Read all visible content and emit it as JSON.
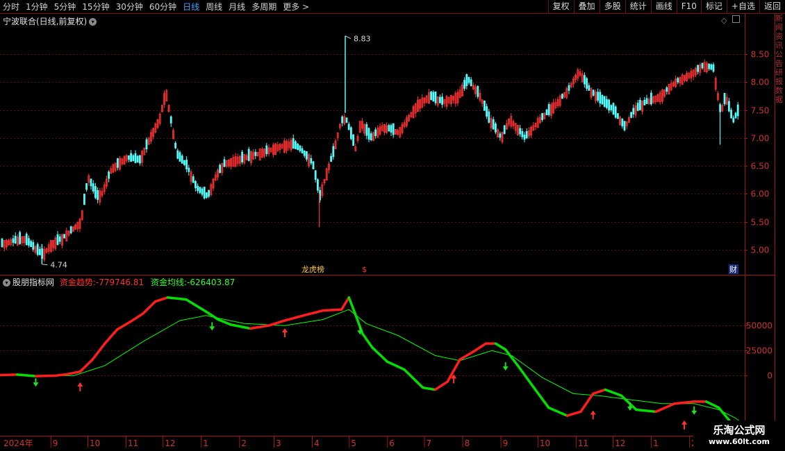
{
  "toolbar": {
    "periods": [
      "分时",
      "1分钟",
      "5分钟",
      "15分钟",
      "30分钟",
      "60分钟",
      "日线",
      "周线",
      "月线",
      "多周期",
      "更多 >"
    ],
    "active_index": 6,
    "buttons": [
      "复权",
      "叠加",
      "多股",
      "统计",
      "画线",
      "F10",
      "标记",
      "+自选",
      "返回"
    ]
  },
  "stock_title": "宁波联合(日线,前复权)",
  "price_pane": {
    "y_ticks": [
      5.0,
      5.5,
      6.0,
      6.5,
      7.0,
      7.5,
      8.0,
      8.5
    ],
    "ylim": [
      4.55,
      9.0
    ],
    "max_label": "8.83",
    "min_label": "4.74",
    "marks": [
      "龙虎榜",
      "$",
      "财"
    ],
    "up_color": "#ff3232",
    "down_color": "#54fcfc"
  },
  "indicator": {
    "name": "股朋指标网",
    "trend_label": "资金趋势:",
    "trend_value": "-779746.81",
    "avg_label": "资金均线:",
    "avg_value": "-626403.87",
    "y_ticks": [
      0,
      25000,
      50000
    ],
    "ylim": [
      -60000,
      100000
    ],
    "rise_color": "#ff1e1e",
    "fall_color": "#00e000",
    "avg_color": "#00ff00"
  },
  "x_axis": {
    "labels": [
      "2024年",
      "9",
      "10",
      "11",
      "12",
      "1",
      "2",
      "3",
      "4",
      "5",
      "6",
      "7",
      "8",
      "9",
      "10",
      "11",
      "12",
      "1",
      "2",
      "3"
    ]
  },
  "right_strip_text": "新闻资讯公告研报数据",
  "badge": {
    "title": "乐淘公式网",
    "url": "www.60lt.com"
  },
  "chart_data": [
    {
      "type": "candlestick",
      "title": "宁波联合(日线,前复权)",
      "ylim": [
        4.55,
        9.0
      ],
      "y_ticks": [
        5.0,
        5.5,
        6.0,
        6.5,
        7.0,
        7.5,
        8.0,
        8.5
      ],
      "annotations": [
        {
          "label": "8.83",
          "value": 8.83
        },
        {
          "label": "4.74",
          "value": 4.74
        }
      ],
      "close_path_x": [
        "2024-07-22",
        "2024-08-10",
        "2024-08-25",
        "2024-09-01",
        "2024-09-10",
        "2024-09-25",
        "2024-10-01",
        "2024-10-08",
        "2024-10-12",
        "2024-10-20",
        "2024-11-01",
        "2024-11-12",
        "2024-11-20",
        "2024-11-28",
        "2024-12-03",
        "2024-12-08",
        "2024-12-12",
        "2024-12-20",
        "2024-12-28",
        "2025-01-06",
        "2025-01-13",
        "2025-01-20",
        "2025-02-05",
        "2025-02-20",
        "2025-03-05",
        "2025-03-15",
        "2025-03-22",
        "2025-04-01",
        "2025-04-07",
        "2025-04-12",
        "2025-04-18",
        "2025-04-24",
        "2025-04-28",
        "2025-05-06",
        "2025-05-10",
        "2025-05-18",
        "2025-05-28",
        "2025-06-10",
        "2025-06-25",
        "2025-07-05",
        "2025-07-15",
        "2025-07-28",
        "2025-08-05",
        "2025-08-15",
        "2025-08-22",
        "2025-09-01",
        "2025-09-08",
        "2025-09-20",
        "2025-10-01",
        "2025-10-15",
        "2025-10-25",
        "2025-11-03",
        "2025-11-12",
        "2025-11-20",
        "2025-12-01",
        "2025-12-10",
        "2025-12-18",
        "2025-12-28",
        "2026-01-08",
        "2026-01-20",
        "2026-02-02",
        "2026-02-12",
        "2026-02-20",
        "2026-02-26",
        "2026-03-02",
        "2026-03-08",
        "2026-03-16"
      ],
      "close_path_y": [
        5.1,
        5.2,
        4.9,
        5.1,
        5.2,
        5.5,
        6.3,
        5.95,
        6.0,
        6.45,
        6.65,
        6.6,
        7.0,
        7.35,
        7.85,
        7.2,
        6.7,
        6.5,
        6.1,
        5.95,
        6.35,
        6.55,
        6.65,
        6.75,
        6.85,
        6.9,
        6.8,
        6.55,
        5.95,
        6.35,
        6.75,
        7.3,
        7.35,
        6.8,
        7.3,
        7.0,
        7.2,
        7.1,
        7.6,
        7.75,
        7.65,
        7.75,
        8.05,
        7.75,
        7.35,
        7.0,
        7.35,
        7.0,
        7.3,
        7.6,
        7.85,
        8.2,
        7.85,
        7.7,
        7.5,
        7.2,
        7.5,
        7.65,
        7.75,
        8.0,
        8.15,
        8.3,
        8.25,
        7.45,
        7.75,
        7.3,
        7.65
      ]
    },
    {
      "type": "line",
      "title": "股朋指标网",
      "ylim": [
        -60000,
        100000
      ],
      "y_ticks": [
        0,
        25000,
        50000
      ],
      "series": [
        {
          "name": "资金趋势",
          "last_value": -779746.81,
          "x": [
            "2024-07-22",
            "2024-08-05",
            "2024-08-20",
            "2024-09-05",
            "2024-09-15",
            "2024-09-25",
            "2024-10-05",
            "2024-10-15",
            "2024-10-25",
            "2024-11-05",
            "2024-11-15",
            "2024-11-25",
            "2024-12-05",
            "2024-12-20",
            "2025-01-05",
            "2025-01-15",
            "2025-01-25",
            "2025-02-10",
            "2025-02-25",
            "2025-03-10",
            "2025-03-25",
            "2025-04-10",
            "2025-04-25",
            "2025-05-01",
            "2025-05-06",
            "2025-05-12",
            "2025-05-20",
            "2025-06-01",
            "2025-06-15",
            "2025-06-30",
            "2025-07-10",
            "2025-07-20",
            "2025-07-30",
            "2025-08-10",
            "2025-08-20",
            "2025-08-28",
            "2025-09-05",
            "2025-09-15",
            "2025-09-28",
            "2025-10-10",
            "2025-10-25",
            "2025-11-05",
            "2025-11-15",
            "2025-11-25",
            "2025-12-08",
            "2025-12-20",
            "2026-01-05",
            "2026-01-20",
            "2026-02-05",
            "2026-02-15",
            "2026-02-25",
            "2026-03-05",
            "2026-03-15"
          ],
          "y": [
            500,
            1000,
            -500,
            0,
            1500,
            4000,
            16000,
            32000,
            46000,
            54000,
            62000,
            74000,
            78000,
            76000,
            64000,
            56000,
            51000,
            47000,
            50000,
            55000,
            60000,
            65000,
            66000,
            78000,
            62000,
            42000,
            28000,
            14000,
            6000,
            -12000,
            -14000,
            -6000,
            16000,
            24000,
            32000,
            32000,
            26000,
            10000,
            -12000,
            -32000,
            -40000,
            -36000,
            -18000,
            -14000,
            -20000,
            -34000,
            -36000,
            -28000,
            -26000,
            -26000,
            -32000,
            -44000,
            -60000
          ]
        },
        {
          "name": "资金均线",
          "last_value": -626403.87,
          "x": [
            "2024-07-22",
            "2024-09-01",
            "2024-09-20",
            "2024-10-15",
            "2024-11-15",
            "2024-12-15",
            "2025-01-05",
            "2025-02-05",
            "2025-03-10",
            "2025-04-10",
            "2025-05-01",
            "2025-05-15",
            "2025-06-10",
            "2025-07-10",
            "2025-07-30",
            "2025-08-25",
            "2025-09-10",
            "2025-10-05",
            "2025-10-30",
            "2025-11-20",
            "2025-12-15",
            "2026-01-10",
            "2026-02-05",
            "2026-02-25",
            "2026-03-10",
            "2026-03-25"
          ],
          "y": [
            500,
            0,
            0,
            10000,
            34000,
            55000,
            60000,
            52000,
            50000,
            56000,
            66000,
            52000,
            40000,
            20000,
            15000,
            25000,
            20000,
            -2000,
            -18000,
            -20000,
            -24000,
            -28000,
            -28000,
            -34000,
            -42000,
            -55000
          ]
        }
      ]
    }
  ]
}
